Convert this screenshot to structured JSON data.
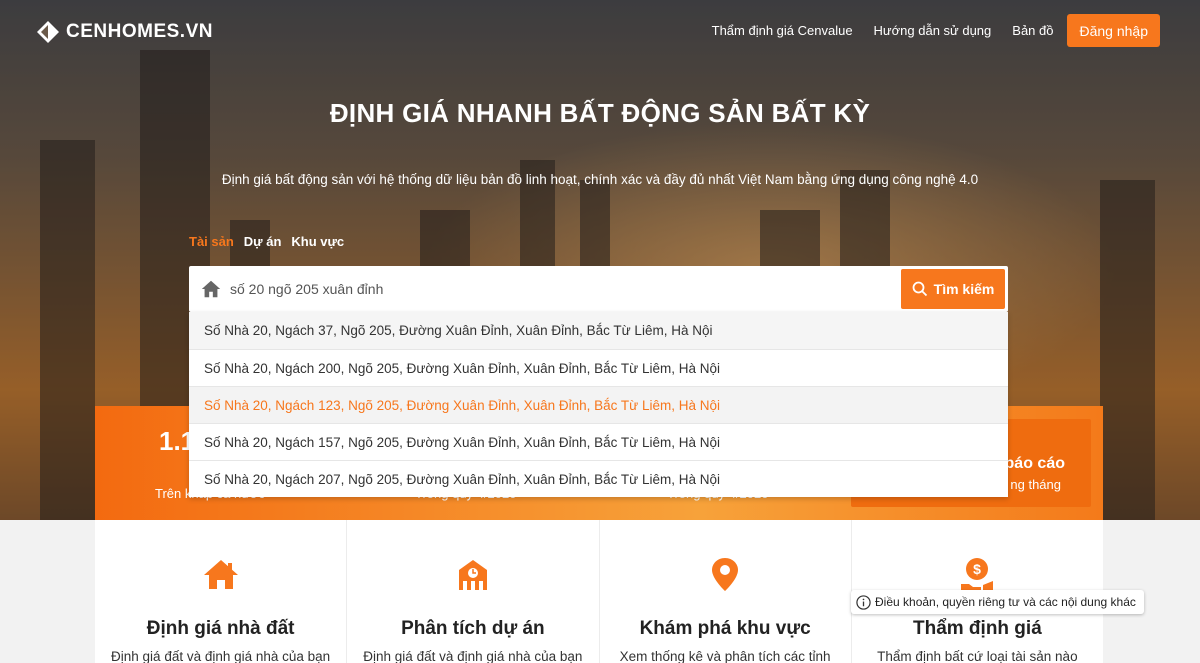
{
  "header": {
    "logo_text": "CENHOMES.VN",
    "nav": [
      {
        "label": "Thẩm định giá Cenvalue"
      },
      {
        "label": "Hướng dẫn sử dụng"
      },
      {
        "label": "Bản đồ"
      }
    ],
    "login_label": "Đăng nhập"
  },
  "hero": {
    "title": "ĐỊNH GIÁ NHANH BẤT ĐỘNG SẢN BẤT KỲ",
    "subtitle": "Định giá bất động sản với hệ thống dữ liệu bản đồ linh hoạt, chính xác và đầy đủ nhất Việt Nam bằng ứng dụng công nghệ 4.0"
  },
  "tabs": [
    {
      "label": "Tài sản",
      "active": true
    },
    {
      "label": "Dự án",
      "active": false
    },
    {
      "label": "Khu vực",
      "active": false
    }
  ],
  "search": {
    "value": "số 20 ngõ 205 xuân đỉnh",
    "button_label": "Tìm kiếm"
  },
  "suggestions": [
    "Số Nhà 20, Ngách 37, Ngõ 205, Đường Xuân Đỉnh, Xuân Đỉnh, Bắc Từ Liêm, Hà Nội",
    "Số Nhà 20, Ngách 200, Ngõ 205, Đường Xuân Đỉnh, Xuân Đỉnh, Bắc Từ Liêm, Hà Nội",
    "Số Nhà 20, Ngách 123, Ngõ 205, Đường Xuân Đỉnh, Xuân Đỉnh, Bắc Từ Liêm, Hà Nội",
    "Số Nhà 20, Ngách 157, Ngõ 205, Đường Xuân Đỉnh, Xuân Đỉnh, Bắc Từ Liêm, Hà Nội",
    "Số Nhà 20, Ngách 207, Ngõ 205, Đường Xuân Đỉnh, Xuân Đỉnh, Bắc Từ Liêm, Hà Nội"
  ],
  "highlighted_suggestion_index": 2,
  "stats": {
    "number_partial": "1.1",
    "label_1": "Trên khắp cả nước",
    "label_2": "Trong quý 4/2020",
    "label_3": "Trong quý 4/2020",
    "report_title": "báo cáo",
    "report_sub": "ng tháng"
  },
  "features": [
    {
      "icon": "house-icon",
      "title": "Định giá nhà đất",
      "desc": "Định giá đất và định giá nhà của bạn"
    },
    {
      "icon": "building-chart-icon",
      "title": "Phân tích dự án",
      "desc": "Định giá đất và định giá nhà của bạn"
    },
    {
      "icon": "map-pin-icon",
      "title": "Khám phá khu vực",
      "desc": "Xem thống kê và phân tích các tỉnh"
    },
    {
      "icon": "coin-hand-icon",
      "title": "Thẩm định giá",
      "desc": "Thẩm định bất cứ loại tài sản nào"
    }
  ],
  "tooltip": "Điều khoản, quyền riêng tư và các nội dung khác",
  "colors": {
    "accent": "#f7771d"
  }
}
